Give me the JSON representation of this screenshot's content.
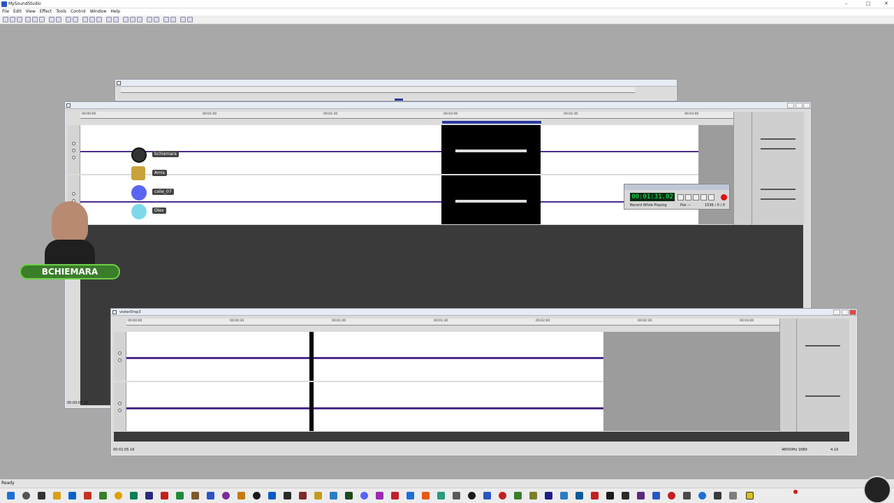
{
  "app": {
    "title": "MySoundStudio",
    "status": "Ready",
    "menu": [
      "File",
      "Edit",
      "View",
      "Effect",
      "Tools",
      "Control",
      "Window",
      "Help"
    ]
  },
  "project_window": {
    "timecodes": [
      "00:00:00",
      "00:01:00",
      "00:01:30",
      "00:02:00",
      "00:02:30",
      "00:03:00"
    ],
    "playhead_pct": 0.6,
    "status_time": "00:00:07.32"
  },
  "participants": [
    {
      "name": "bchiemara",
      "icon": "avatar-photo-icon"
    },
    {
      "name": "Amix",
      "icon": "gold-figure-icon"
    },
    {
      "name": "calie_07",
      "icon": "discord-icon"
    },
    {
      "name": "Olex",
      "icon": "cyan-circle-icon"
    }
  ],
  "transport": {
    "time": "00:01:31.02",
    "record_mode": "Record While Playing",
    "position_label": "Pos ---",
    "rate": "1536 / 0 / 0"
  },
  "webcam": {
    "brand": "BCHIEMARA"
  },
  "mix_window": {
    "title": "visiterDrop3",
    "timecodes": [
      "00:00:00",
      "00:00:30",
      "00:01:00",
      "00:01:30",
      "00:02:00",
      "00:02:30",
      "00:03:00"
    ],
    "status_time": "00:01:05.16",
    "format": "48000Hz 16Bit",
    "duration": "4:19"
  },
  "colors": {
    "wave": "#4b2a8a",
    "selection": "#000000",
    "lcd": "#23ff5a",
    "desktop": "#a8a8a8"
  }
}
